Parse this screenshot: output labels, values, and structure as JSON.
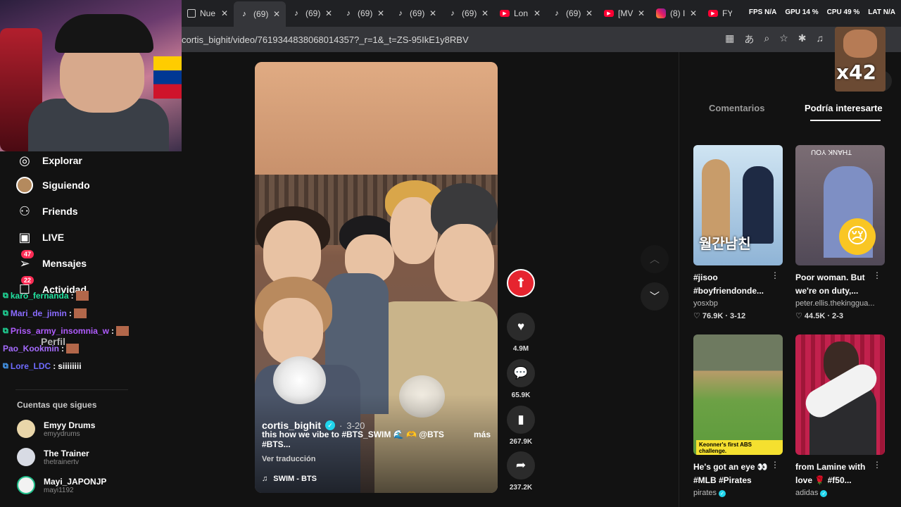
{
  "tabs": [
    {
      "title": "Nue",
      "icon": "doc"
    },
    {
      "title": "(69)",
      "icon": "tiktok"
    },
    {
      "title": "(69)",
      "icon": "tiktok"
    },
    {
      "title": "(69)",
      "icon": "tiktok"
    },
    {
      "title": "(69)",
      "icon": "tiktok"
    },
    {
      "title": "(69)",
      "icon": "tiktok"
    },
    {
      "title": "Lon",
      "icon": "youtube"
    },
    {
      "title": "(69)",
      "icon": "tiktok"
    },
    {
      "title": "[MV",
      "icon": "youtube"
    },
    {
      "title": "(8) I",
      "icon": "instagram"
    },
    {
      "title": "FYA",
      "icon": "youtube"
    }
  ],
  "perf": {
    "fps": "FPS N/A",
    "gpu": "GPU 14 %",
    "cpu": "CPU 49 %",
    "lat": "LAT N/A"
  },
  "address": {
    "url": "cortis_bighit/video/7619344838068014357?_r=1&_t=ZS-95IkE1y8RBV"
  },
  "nav": [
    {
      "label": "Explorar",
      "icon": "compass-icon"
    },
    {
      "label": "Siguiendo",
      "icon": "following-avatar-icon"
    },
    {
      "label": "Friends",
      "icon": "friends-icon"
    },
    {
      "label": "LIVE",
      "icon": "live-icon"
    },
    {
      "label": "Mensajes",
      "icon": "messages-icon",
      "badge": "47"
    },
    {
      "label": "Actividad",
      "icon": "activity-icon",
      "badge": "22"
    },
    {
      "label": "Perfil",
      "icon": "profile-icon"
    }
  ],
  "chat": [
    {
      "user": "karo_fernanda",
      "color": "#21e3a0",
      "msg": ""
    },
    {
      "user": "Mari_de_jimin",
      "color": "#8a6cff",
      "msg": ""
    },
    {
      "user": "Priss_army_insomnia_w",
      "color": "#b05cff",
      "msg": ""
    },
    {
      "user": "Pao_Kookmin",
      "color": "#a56bff",
      "msg": ""
    },
    {
      "user": "Lore_LDC",
      "color": "#6f6bff",
      "msg": "siiiiiiii"
    }
  ],
  "following_heading": "Cuentas que sigues",
  "accounts": [
    {
      "name": "Emyy Drums",
      "handle": "emyydrums"
    },
    {
      "name": "The Trainer",
      "handle": "thetrainertv"
    },
    {
      "name": "Mayi_JAPONJP",
      "handle": "mayi1192"
    }
  ],
  "video": {
    "author": "cortis_bighit",
    "date": "3-20",
    "caption": "this how we vibe to #BTS_SWIM 🌊 🫶 @BTS #BTS...",
    "more": "más",
    "translate": "Ver traducción",
    "sound": "SWIM - BTS"
  },
  "actions": {
    "likes": "4.9M",
    "comments": "65.9K",
    "saves": "267.9K",
    "shares": "237.2K"
  },
  "right_panel": {
    "tab_comments": "Comentarios",
    "tab_interest": "Podría interesarte",
    "sticker_text": "x42"
  },
  "cards": [
    {
      "title": "#jisoo #boyfriendonde...",
      "author": "yosxbp",
      "stats": "♡ 76.9K · 3-12",
      "thumb_text": "월간남친"
    },
    {
      "title": "Poor woman. But we're on duty,...",
      "author": "peter.ellis.thekinggua...",
      "stats": "♡ 44.5K · 2-3",
      "thumb_text": "THANK YOU"
    },
    {
      "title": "He's got an eye 👀 #MLB #Pirates",
      "author": "pirates",
      "stats": "",
      "thumb_text": "Keonner's first ABS challenge."
    },
    {
      "title": "from Lamine with love 🌹 #f50...",
      "author": "adidas",
      "stats": "",
      "thumb_text": ""
    }
  ]
}
